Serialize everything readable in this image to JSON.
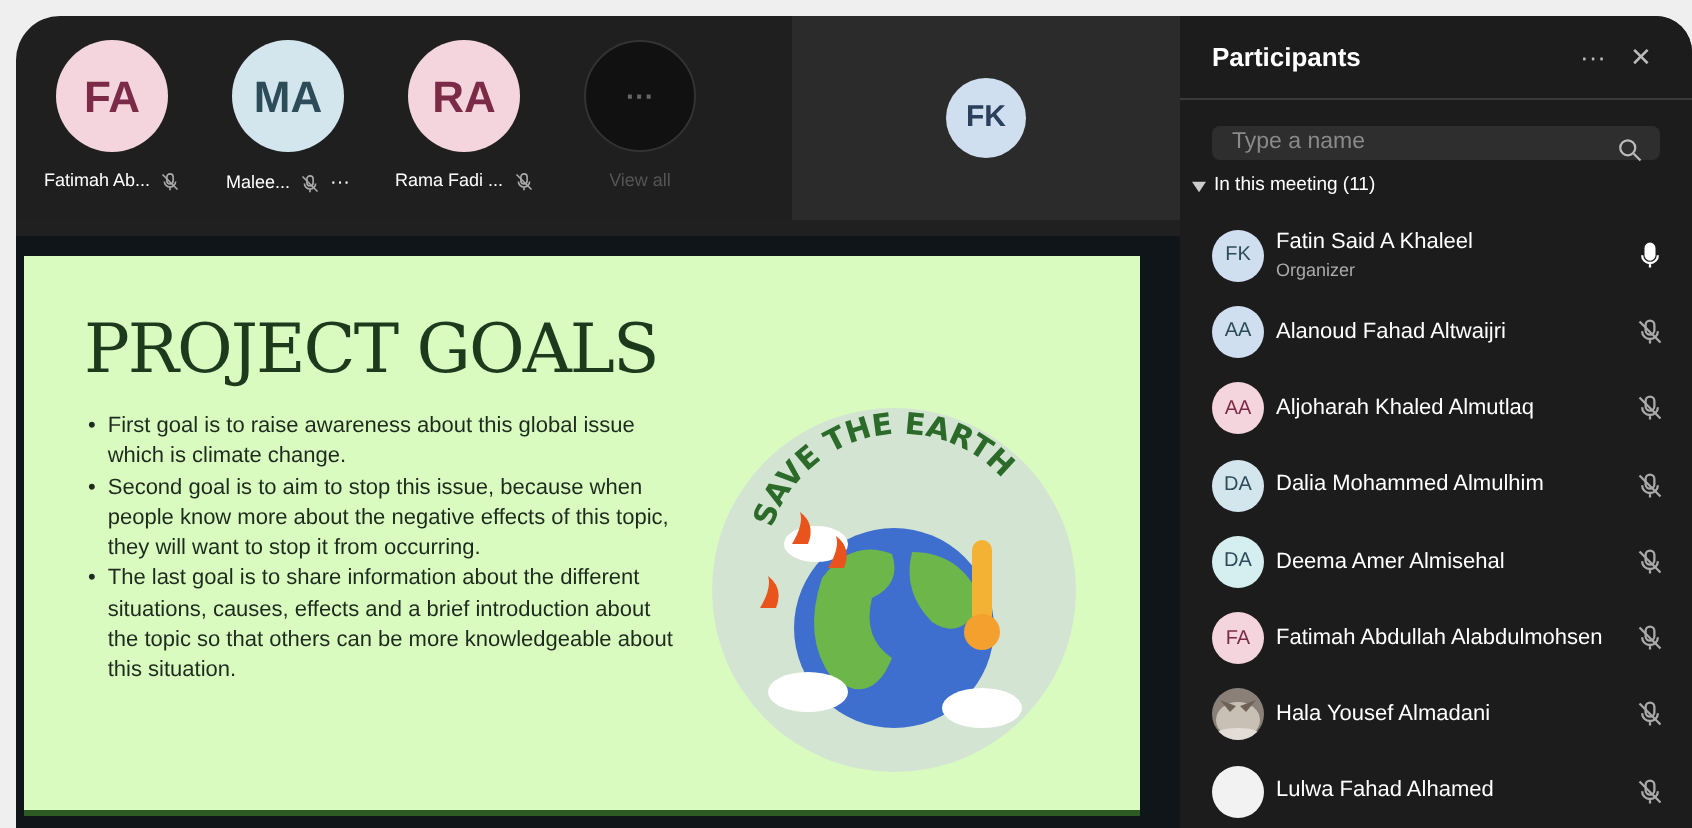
{
  "top_strip": {
    "participants": [
      {
        "kind": "avatar",
        "initials": "FA",
        "color": "#f5d5dd",
        "name": "Fatimah Ab...",
        "muted": true
      },
      {
        "kind": "avatar",
        "initials": "MA",
        "color": "#d3e6ee",
        "name": "Malee...",
        "muted": true,
        "more": "···"
      },
      {
        "kind": "avatar",
        "initials": "RA",
        "color": "#f5d5dd",
        "name": "Rama Fadi ...",
        "muted": true
      },
      {
        "kind": "view_all",
        "initials": "···",
        "name": "View all",
        "disabled": true
      }
    ],
    "video_tile": {
      "initials": "FK",
      "color": "#cfdff0"
    }
  },
  "slide": {
    "title": "PROJECT GOALS",
    "bullets": [
      {
        "marker": "•",
        "text": "First goal is to raise awareness about this global issue which is climate change."
      },
      {
        "marker": "•",
        "text": "Second goal is to aim to stop this issue, because when people know more about the negative effects of this topic, they will want to stop it from occurring."
      },
      {
        "marker": "•",
        "text": "The last goal is to share information about the different situations, causes, effects and a brief introduction about the topic so that others can be more knowledgeable about this situation."
      }
    ],
    "badge_text": "SAVE THE EARTH"
  },
  "panel": {
    "title": "Participants",
    "more": "···",
    "close": "✕",
    "search": {
      "placeholder": "Type a name"
    },
    "section": {
      "label": "In this meeting (11)",
      "expanded": true
    },
    "people": [
      {
        "kind": "initials",
        "initials": "FK",
        "color": "#cfdff0",
        "name": "Fatin Said A Khaleel",
        "role": "Organizer",
        "muted": false
      },
      {
        "kind": "initials",
        "initials": "AA",
        "color": "#cfdff0",
        "name": "Alanoud Fahad Altwaijri",
        "muted": true
      },
      {
        "kind": "initials",
        "initials": "AA",
        "color": "#f5d5dd",
        "name": "Aljoharah Khaled Almutlaq",
        "muted": true
      },
      {
        "kind": "initials",
        "initials": "DA",
        "color": "#d3e6ee",
        "name": "Dalia Mohammed Almulhim",
        "muted": true
      },
      {
        "kind": "initials",
        "initials": "DA",
        "color": "#d5eef0",
        "name": "Deema Amer Almisehal",
        "muted": true
      },
      {
        "kind": "initials",
        "initials": "FA",
        "color": "#f5d5dd",
        "name": "Fatimah Abdullah Alabdulmohsen",
        "muted": true
      },
      {
        "kind": "picture",
        "name": "Hala Yousef Almadani",
        "muted": true
      },
      {
        "kind": "plain",
        "color": "#f2f2f2",
        "name": "Lulwa Fahad Alhamed",
        "muted": true
      }
    ]
  }
}
